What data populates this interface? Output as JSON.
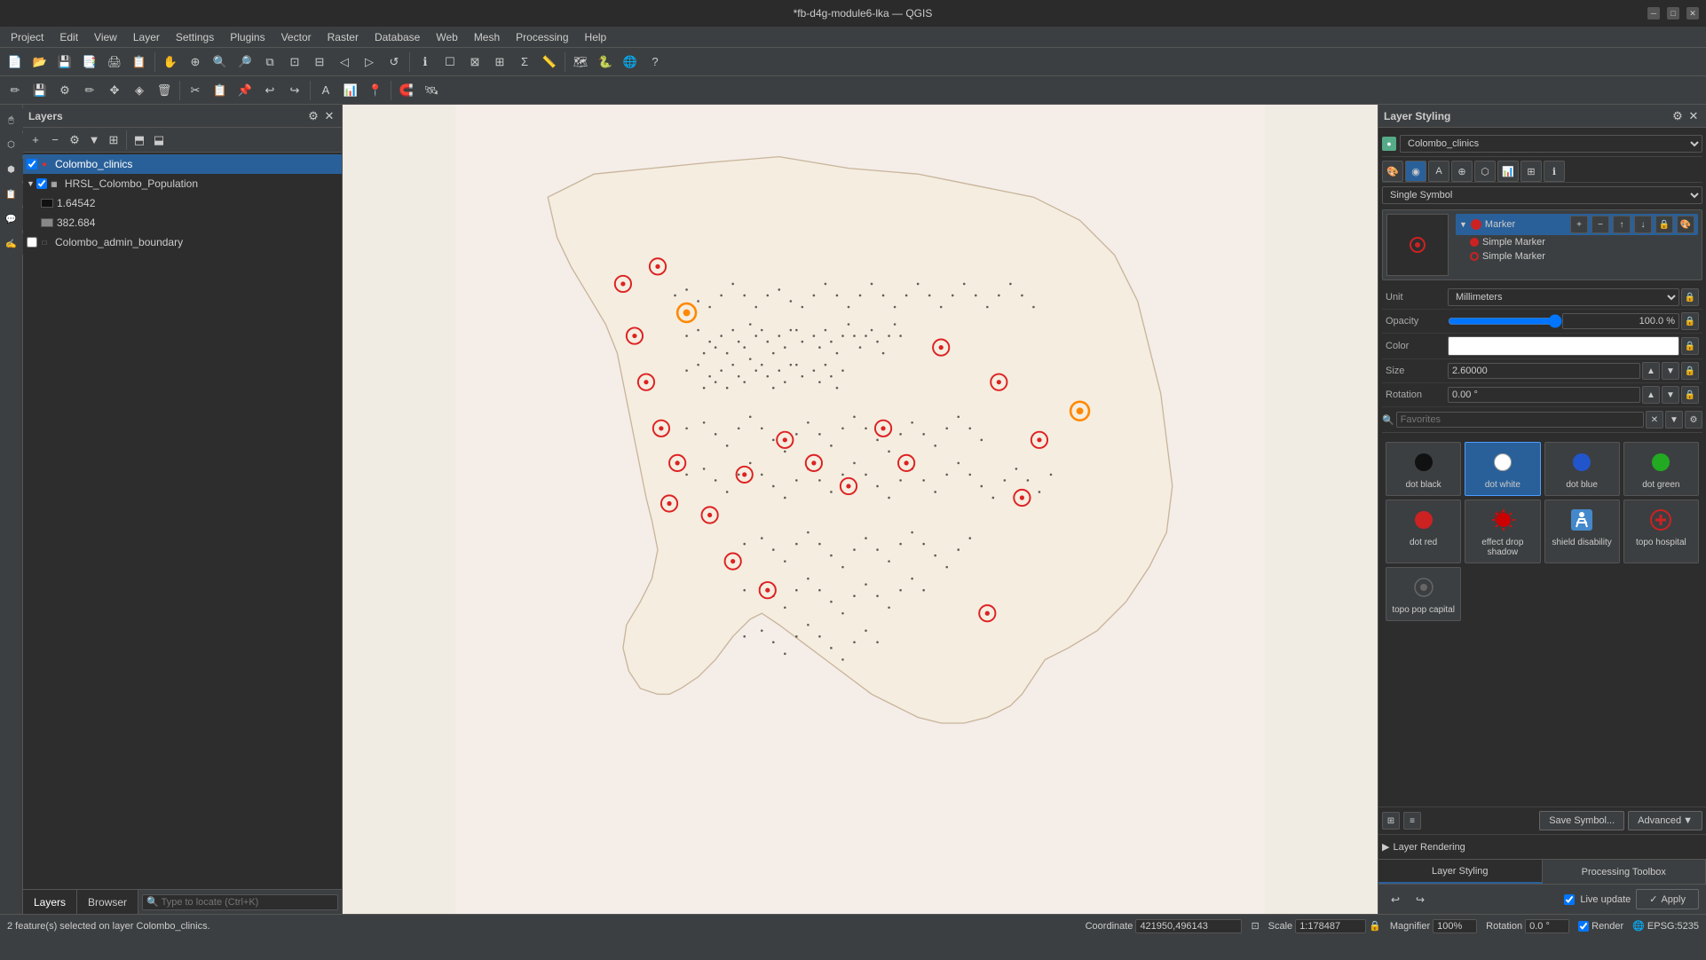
{
  "window": {
    "title": "*fb-d4g-module6-lka — QGIS"
  },
  "menu": {
    "items": [
      "Project",
      "Edit",
      "View",
      "Layer",
      "Settings",
      "Plugins",
      "Vector",
      "Raster",
      "Database",
      "Web",
      "Mesh",
      "Processing",
      "Help"
    ]
  },
  "layers_panel": {
    "title": "Layers",
    "layers": [
      {
        "id": "colombo_clinics",
        "label": "Colombo_clinics",
        "checked": true,
        "selected": true,
        "level": 0
      },
      {
        "id": "hrsl_colombo",
        "label": "HRSL_Colombo_Population",
        "checked": true,
        "selected": false,
        "level": 0
      },
      {
        "id": "raster_1",
        "label": "1.64542",
        "checked": false,
        "selected": false,
        "level": 1
      },
      {
        "id": "raster_2",
        "label": "382.684",
        "checked": false,
        "selected": false,
        "level": 1
      },
      {
        "id": "colombo_admin",
        "label": "Colombo_admin_boundary",
        "checked": false,
        "selected": false,
        "level": 0
      }
    ]
  },
  "styling_panel": {
    "title": "Layer Styling",
    "layer_name": "Colombo_clinics",
    "style_type": "Single Symbol",
    "unit": "Millimeters",
    "opacity": "100.0 %",
    "color": "",
    "size": "2.60000",
    "rotation": "0.00 °",
    "symbol_tree": {
      "marker_label": "Marker",
      "simple_marker_1": "Simple Marker",
      "simple_marker_2": "Simple Marker"
    },
    "favorites_placeholder": "Favorites",
    "symbols": [
      {
        "id": "dot_black",
        "label": "dot  black",
        "type": "dot_black"
      },
      {
        "id": "dot_white",
        "label": "dot  white",
        "type": "dot_white",
        "selected": true
      },
      {
        "id": "dot_blue",
        "label": "dot blue",
        "type": "dot_blue"
      },
      {
        "id": "dot_green",
        "label": "dot green",
        "type": "dot_green"
      },
      {
        "id": "dot_red",
        "label": "dot red",
        "type": "dot_red"
      },
      {
        "id": "effect_drop_shadow",
        "label": "effect drop shadow",
        "type": "effect_drop"
      },
      {
        "id": "shield_disability",
        "label": "shield disability",
        "type": "shield"
      },
      {
        "id": "topo_hospital",
        "label": "topo hospital",
        "type": "hospital"
      },
      {
        "id": "topo_pop_capital",
        "label": "topo pop capital",
        "type": "topo_pop"
      }
    ],
    "save_symbol_label": "Save Symbol...",
    "advanced_label": "Advanced",
    "layer_rendering_label": "Layer Rendering",
    "live_update_label": "Live update",
    "apply_label": "Apply"
  },
  "bottom_tabs": {
    "layer_styling": "Layer Styling",
    "processing_toolbox": "Processing Toolbox"
  },
  "layers_bottom_tabs": {
    "layers": "Layers",
    "browser": "Browser"
  },
  "status_bar": {
    "message": "2 feature(s) selected on layer Colombo_clinics.",
    "coordinate_label": "Coordinate",
    "coordinate_value": "421950,496143",
    "scale_label": "Scale",
    "scale_value": "1:178487",
    "magnifier_label": "Magnifier",
    "magnifier_value": "100%",
    "rotation_label": "Rotation",
    "rotation_value": "0.0 °",
    "render_label": "Render",
    "crs_label": "EPSG:5235"
  }
}
